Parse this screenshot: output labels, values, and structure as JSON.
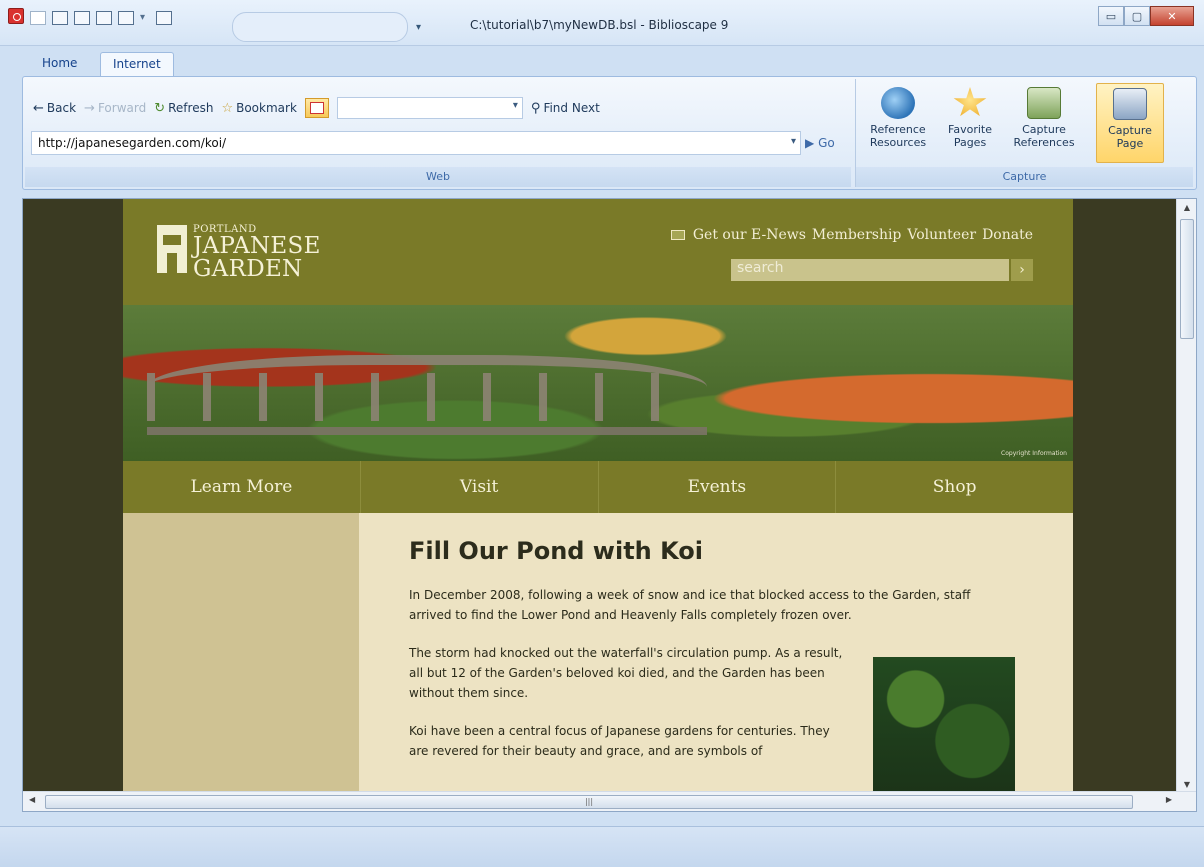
{
  "window": {
    "title": "C:\\tutorial\\b7\\myNewDB.bsl - Biblioscape 9",
    "controls": {
      "minimize": "▭",
      "maximize": "▢",
      "close": "✕"
    }
  },
  "tabs": {
    "home": "Home",
    "internet": "Internet"
  },
  "ribbon": {
    "web": {
      "back": "Back",
      "forward": "Forward",
      "refresh": "Refresh",
      "bookmark": "Bookmark",
      "find_next": "Find Next",
      "url": "http://japanesegarden.com/koi/",
      "go": "Go",
      "group_label": "Web"
    },
    "capture": {
      "reference_resources": [
        "Reference",
        "Resources"
      ],
      "favorite_pages": [
        "Favorite",
        "Pages"
      ],
      "capture_references": [
        "Capture",
        "References"
      ],
      "capture_page": [
        "Capture",
        "Page"
      ],
      "group_label": "Capture"
    }
  },
  "site": {
    "logo": {
      "small": "PORTLAND",
      "line1": "JAPANESE",
      "line2": "GARDEN"
    },
    "topnav": [
      "Get our E-News",
      "Membership",
      "Volunteer",
      "Donate"
    ],
    "search_placeholder": "search",
    "banner_credit": "Copyright Information",
    "mainnav": [
      "Learn More",
      "Visit",
      "Events",
      "Shop"
    ],
    "article": {
      "title": "Fill Our Pond with Koi",
      "p1": "In December 2008, following a week of snow and ice that blocked access to the Garden, staff arrived to find the Lower Pond and Heavenly Falls completely frozen over.",
      "p2": "The storm had knocked out the waterfall's circulation pump. As a result, all but 12 of the Garden's beloved koi died, and the Garden has been without them since.",
      "p3": "Koi have been a central focus of Japanese gardens for centuries. They are revered for their beauty and grace, and are symbols of"
    }
  }
}
